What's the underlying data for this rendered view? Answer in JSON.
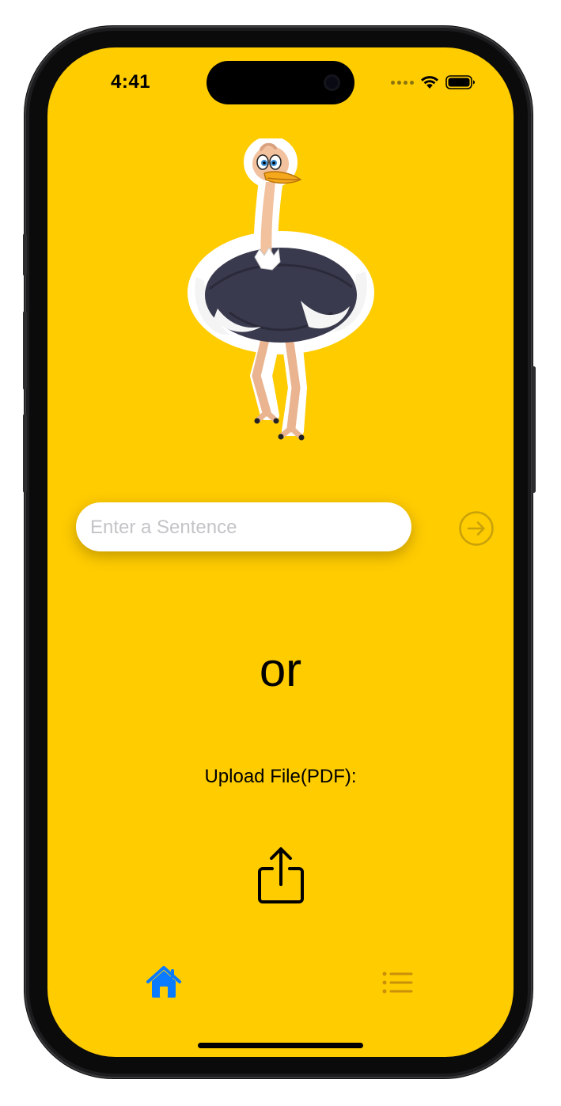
{
  "status_bar": {
    "time": "4:41",
    "wifi_icon": "wifi-icon",
    "battery_icon": "battery-icon",
    "signal_icon": "signal-dots-icon"
  },
  "hero": {
    "image": "ostrich-illustration"
  },
  "sentence_input": {
    "placeholder": "Enter a Sentence",
    "value": "",
    "submit_icon": "arrow-right-circle-icon"
  },
  "divider_text": "or",
  "upload": {
    "label": "Upload File(PDF):",
    "icon": "share-upload-icon"
  },
  "tab_bar": {
    "items": [
      {
        "id": "home",
        "icon": "house-icon",
        "selected": true
      },
      {
        "id": "list",
        "icon": "list-icon",
        "selected": false
      }
    ]
  },
  "colors": {
    "background": "#ffcc00",
    "tab_selected": "#0a7aff",
    "tab_unselected": "#c9900a",
    "submit_disabled": "#c9a10a"
  }
}
